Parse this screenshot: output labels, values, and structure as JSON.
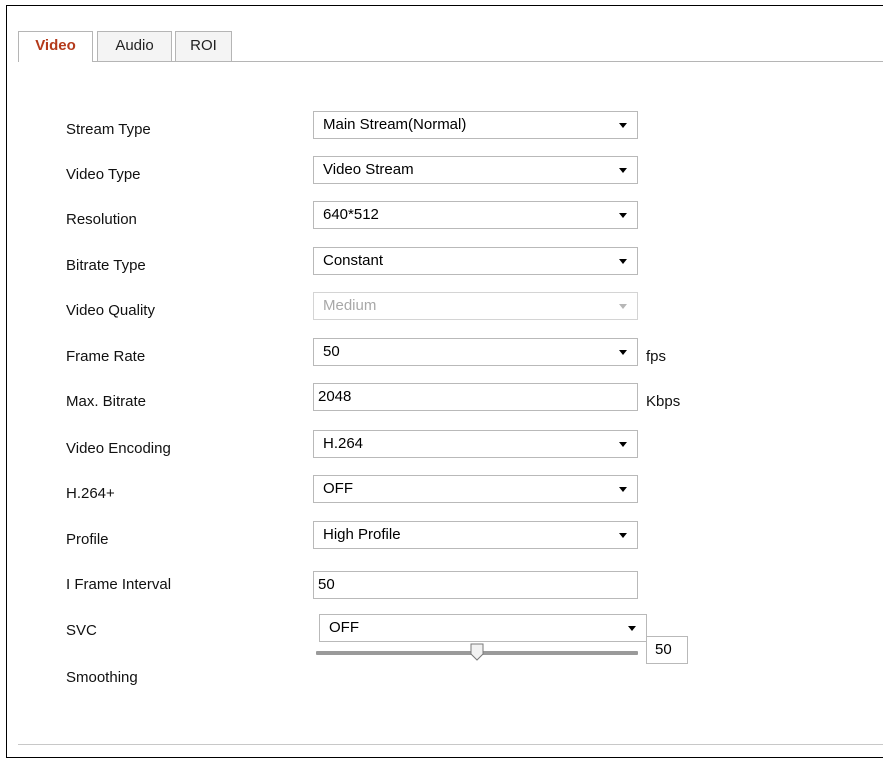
{
  "tabs": [
    {
      "label": "Video",
      "active": true
    },
    {
      "label": "Audio",
      "active": false
    },
    {
      "label": "ROI",
      "active": false
    }
  ],
  "fields": {
    "stream_type": {
      "label": "Stream Type",
      "value": "Main Stream(Normal)"
    },
    "video_type": {
      "label": "Video Type",
      "value": "Video Stream"
    },
    "resolution": {
      "label": "Resolution",
      "value": "640*512"
    },
    "bitrate_type": {
      "label": "Bitrate Type",
      "value": "Constant"
    },
    "video_quality": {
      "label": "Video Quality",
      "value": "Medium",
      "disabled": true
    },
    "frame_rate": {
      "label": "Frame Rate",
      "value": "50",
      "unit": "fps"
    },
    "max_bitrate": {
      "label": "Max. Bitrate",
      "value": "2048",
      "unit": "Kbps"
    },
    "video_encoding": {
      "label": "Video Encoding",
      "value": "H.264"
    },
    "h264_plus": {
      "label": "H.264+",
      "value": "OFF"
    },
    "profile": {
      "label": "Profile",
      "value": "High Profile"
    },
    "i_frame_interval": {
      "label": "I Frame Interval",
      "value": "50"
    },
    "svc": {
      "label": "SVC",
      "value": "OFF"
    },
    "smoothing": {
      "label": "Smoothing",
      "value": "50",
      "min": 0,
      "max": 100
    }
  },
  "colors": {
    "active_tab_text": "#b43a1b",
    "border": "#b9b9b9"
  }
}
